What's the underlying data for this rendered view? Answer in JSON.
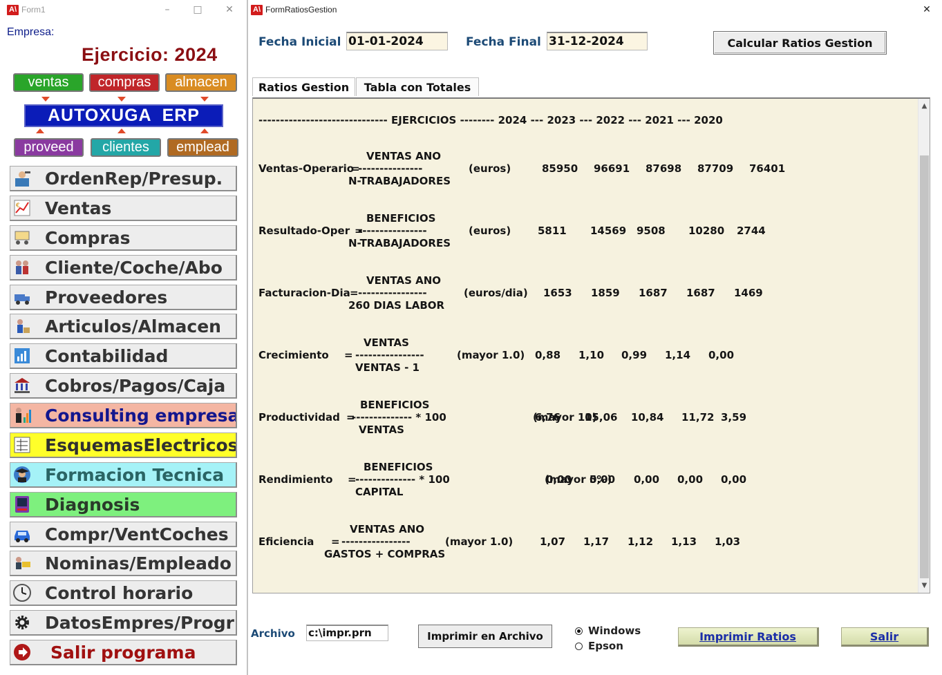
{
  "form1": {
    "title": "Form1",
    "empresa_label": "Empresa:",
    "ejercicio": "Ejercicio: 2024",
    "modules_top": [
      "ventas",
      "compras",
      "almacen"
    ],
    "banner": "AUTOXUGA  ERP",
    "modules_bottom": [
      "proveed",
      "clientes",
      "emplead"
    ],
    "menu": [
      {
        "label": "OrdenRep/Presup.",
        "icon": "mechanic-icon"
      },
      {
        "label": "Ventas",
        "icon": "sales-chart-icon"
      },
      {
        "label": "Compras",
        "icon": "purchases-icon"
      },
      {
        "label": "Cliente/Coche/Abo",
        "icon": "customers-icon"
      },
      {
        "label": "Proveedores",
        "icon": "suppliers-icon"
      },
      {
        "label": "Articulos/Almacen",
        "icon": "warehouse-icon"
      },
      {
        "label": "Contabilidad",
        "icon": "accounting-icon"
      },
      {
        "label": "Cobros/Pagos/Caja",
        "icon": "bank-icon"
      },
      {
        "label": "Consulting empresa",
        "icon": "consulting-icon"
      },
      {
        "label": "EsquemasElectricos",
        "icon": "schematic-icon"
      },
      {
        "label": "Formacion Tecnica",
        "icon": "graduate-icon"
      },
      {
        "label": "Diagnosis",
        "icon": "diagnosis-icon"
      },
      {
        "label": "Compr/VentCoches",
        "icon": "car-icon"
      },
      {
        "label": "Nominas/Empleado",
        "icon": "payroll-icon"
      },
      {
        "label": "Control horario",
        "icon": "clock-icon"
      },
      {
        "label": "DatosEmpres/Progr",
        "icon": "gear-icon"
      },
      {
        "label": "Salir programa",
        "icon": "exit-icon"
      }
    ],
    "colors": {
      "ventas": "#2aa52a",
      "compras": "#c0262a",
      "almacen": "#d98c22",
      "proveed": "#8a3aa0",
      "clientes": "#23a7a7",
      "emplead": "#b06a22",
      "consulting_bg": "#f4b6a3",
      "consulting_text": "#13168e",
      "esquemas_bg": "#ffff2a",
      "formacion_bg": "#a5f2f7",
      "diagnosis_bg": "#7ef07e",
      "salir_text": "#a01010"
    }
  },
  "ratios": {
    "title": "FormRatiosGestion",
    "fecha_inicial_label": "Fecha Inicial",
    "fecha_inicial": "01-01-2024",
    "fecha_final_label": "Fecha Final",
    "fecha_final": "31-12-2024",
    "calc_button": "Calcular Ratios Gestion",
    "tabs": [
      "Ratios Gestion",
      "Tabla con Totales"
    ],
    "header": "------------------------------ EJERCICIOS -------- 2024 --- 2023 --- 2022 --- 2021 --- 2020",
    "rows": [
      {
        "name": "Ventas-Operario",
        "eq": "=",
        "top": "VENTAS ANO",
        "line": "---------------",
        "bottom": "N-TRABAJADORES",
        "unit": "(euros)",
        "values": [
          "85950",
          "96691",
          "87698",
          "87709",
          "76401"
        ]
      },
      {
        "name": "Resultado-Oper",
        "eq": "=",
        "top": "BENEFICIOS",
        "line": "----------------",
        "bottom": "N-TRABAJADORES",
        "unit": "(euros)",
        "values": [
          "5811",
          "14569",
          "9508",
          "10280",
          "2744"
        ]
      },
      {
        "name": "Facturacion-Dia",
        "eq": "=",
        "top": "VENTAS ANO",
        "line": "----------------",
        "bottom": "260 DIAS LABOR",
        "unit": "(euros/dia)",
        "values": [
          "1653",
          "1859",
          "1687",
          "1687",
          "1469"
        ]
      },
      {
        "name": "Crecimiento",
        "eq": "=",
        "top": "VENTAS",
        "line": "----------------",
        "bottom": "VENTAS - 1",
        "unit": "(mayor 1.0)",
        "values": [
          "0,88",
          "1,10",
          "0,99",
          "1,14",
          "0,00"
        ]
      },
      {
        "name": "Productividad",
        "eq": "=",
        "top": "BENEFICIOS",
        "line": "-------------- * 100",
        "bottom": "VENTAS",
        "unit": "(mayor 10)",
        "values": [
          "6,76",
          "15,06",
          "10,84",
          "11,72",
          "3,59"
        ]
      },
      {
        "name": "Rendimiento",
        "eq": "=",
        "top": "BENEFICIOS",
        "line": "-------------- * 100",
        "bottom": "CAPITAL",
        "unit": "(mayor 5%)",
        "values": [
          "0,00",
          "0,00",
          "0,00",
          "0,00",
          "0,00"
        ]
      },
      {
        "name": "Eficiencia",
        "eq": "=",
        "top": "VENTAS ANO",
        "line": "----------------",
        "bottom": "GASTOS + COMPRAS",
        "unit": "(mayor 1.0)",
        "values": [
          "1,07",
          "1,17",
          "1,12",
          "1,13",
          "1,03"
        ]
      }
    ],
    "archivo_label": "Archivo",
    "archivo_value": "c:\\impr.prn",
    "print_file_button": "Imprimir en Archivo",
    "printers": [
      {
        "label": "Windows",
        "selected": true
      },
      {
        "label": "Epson",
        "selected": false
      }
    ],
    "print_button": "Imprimir Ratios",
    "exit_button": "Salir"
  }
}
